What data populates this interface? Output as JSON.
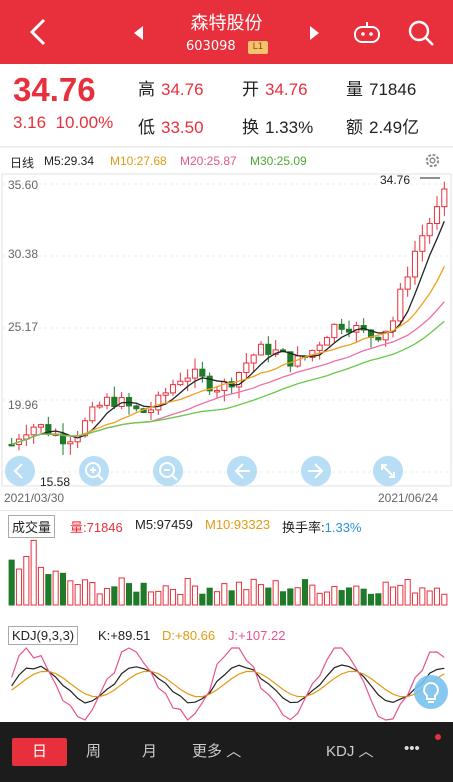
{
  "header": {
    "title": "森特股份",
    "code": "603098",
    "level": "L1",
    "back_icon": "back-icon",
    "robot_icon": "robot-icon",
    "search_icon": "search-icon"
  },
  "quote": {
    "price": "34.76",
    "change": "3.16",
    "change_pct": "10.00%",
    "high_label": "高",
    "high": "34.76",
    "open_label": "开",
    "open": "34.76",
    "volume_label": "量",
    "volume": "71846",
    "low_label": "低",
    "low": "33.50",
    "turnover_label": "换",
    "turnover": "1.33%",
    "amount_label": "额",
    "amount": "2.49亿"
  },
  "kline": {
    "period": "日线",
    "ma5": "M5:29.34",
    "ma10": "M10:27.68",
    "ma20": "M20:25.87",
    "ma30": "M30:25.09",
    "y_labels": [
      "35.60",
      "30.38",
      "25.17",
      "19.96"
    ],
    "marker_high": "34.76",
    "marker_low": "15.58",
    "date_start": "2021/03/30",
    "date_end": "2021/06/24",
    "colors": {
      "ma5": "#222222",
      "ma10": "#f0a020",
      "ma20": "#ef6fa6",
      "ma30": "#6ac84a",
      "up": "#e8303d",
      "down": "#1f7a2a"
    }
  },
  "volume": {
    "label": "成交量",
    "vol": "量:71846",
    "m5": "M5:97459",
    "m10": "M10:93323",
    "turnover_label": "换手率:",
    "turnover": "1.33%"
  },
  "kdj": {
    "label": "KDJ(9,3,3)",
    "k": "K:+89.51",
    "d": "D:+80.66",
    "j": "J:+107.22"
  },
  "tabs": {
    "day": "日",
    "week": "周",
    "month": "月",
    "more": "更多",
    "indicator": "KDJ",
    "menu": "•••"
  },
  "chart_data": {
    "type": "candlestick",
    "series": [
      {
        "name": "M5"
      },
      {
        "name": "M10"
      },
      {
        "name": "M20"
      },
      {
        "name": "M30"
      }
    ],
    "ylim": [
      15.58,
      35.6
    ],
    "last_close": 34.76,
    "last_volume": 71846
  }
}
